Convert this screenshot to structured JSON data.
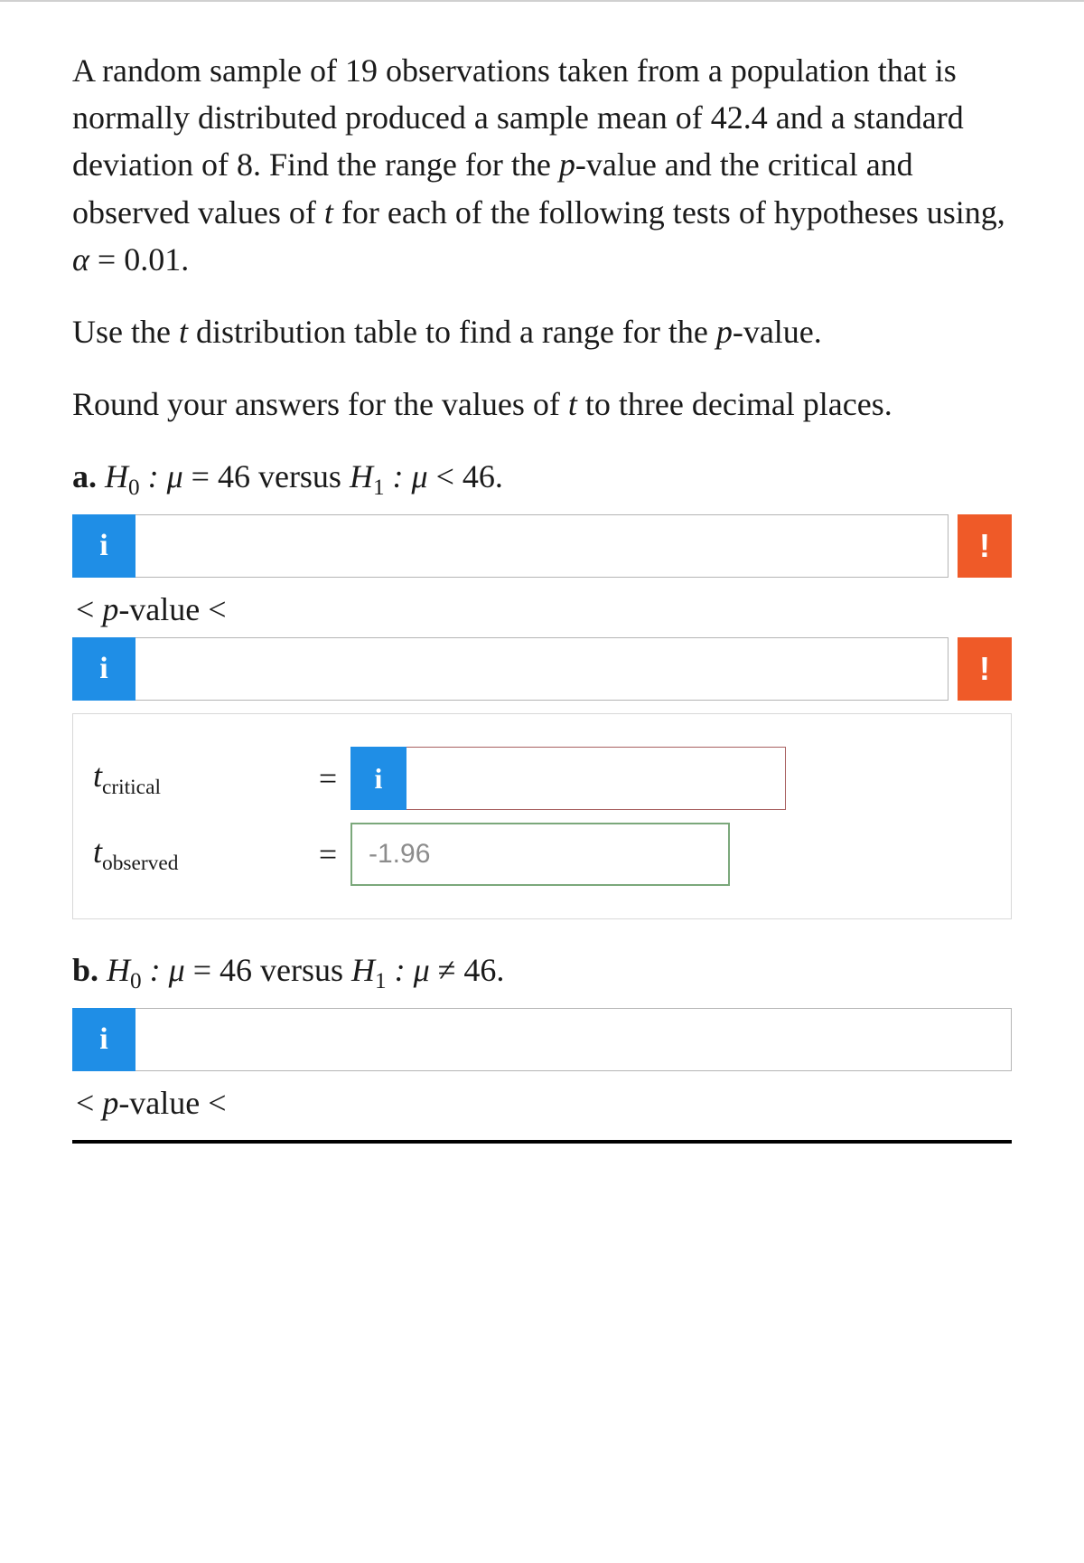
{
  "intro": {
    "p1": "A random sample of 19 observations taken from a population that is normally distributed produced a sample mean of 42.4 and a standard deviation of 8. Find the range for the p-value and the critical and observed values of t for each of the following tests of hypotheses using, α = 0.01.",
    "p2": "Use the t distribution table to find a range for the p-value.",
    "p3": "Round your answers for the values of t to three decimal places."
  },
  "info_icon": "i",
  "error_icon": "!",
  "part_a": {
    "label_prefix": "a. ",
    "h0_lhs": "H",
    "h0_sub": "0",
    "h0_body": ": μ = 46 versus ",
    "h1_lhs": "H",
    "h1_sub": "1",
    "h1_body": ": μ < 46.",
    "pvalue_label": "< p-value <",
    "tcrit_label": "t",
    "tcrit_sub": "critical",
    "tobs_label": "t",
    "tobs_sub": "observed",
    "equals": "=",
    "tobs_value": "-1.96"
  },
  "part_b": {
    "label_prefix": "b. ",
    "h0_lhs": "H",
    "h0_sub": "0",
    "h0_body": ": μ = 46 versus ",
    "h1_lhs": "H",
    "h1_sub": "1",
    "h1_body": ": μ ≠ 46.",
    "pvalue_label": "< p-value <"
  }
}
